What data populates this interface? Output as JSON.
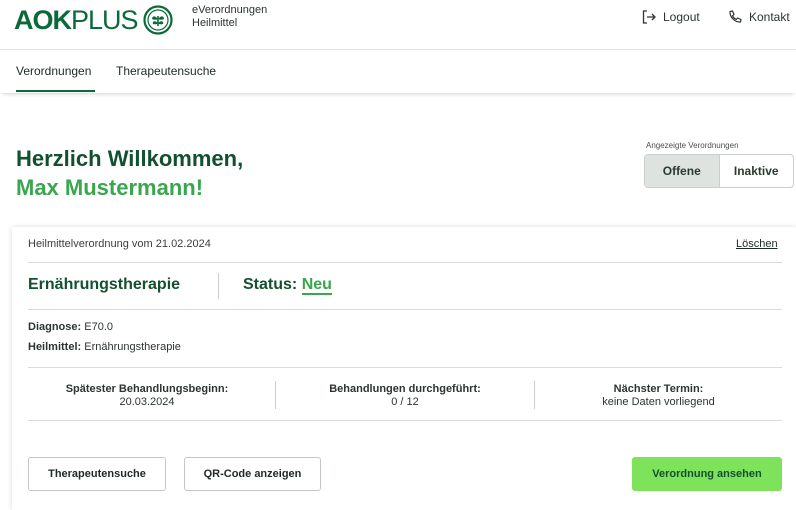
{
  "brand": {
    "logo_bold": "AOK",
    "logo_light": "PLUS"
  },
  "app": {
    "line1": "eVerordnungen",
    "line2": "Heilmittel"
  },
  "header": {
    "logout": "Logout",
    "kontakt": "Kontakt"
  },
  "nav": {
    "tabs": [
      "Verordnungen",
      "Therapeutensuche"
    ]
  },
  "welcome": {
    "line1": "Herzlich Willkommen,",
    "line2": "Max Mustermann!"
  },
  "filter": {
    "label": "Angezeigte Verordnungen",
    "options": [
      "Offene",
      "Inaktive"
    ],
    "selected": "Offene"
  },
  "prescription": {
    "header": "Heilmittelverordnung vom 21.02.2024",
    "delete": "Löschen",
    "therapy": "Ernährungstherapie",
    "status_label": "Status:",
    "status_value": "Neu",
    "diagnosis_label": "Diagnose:",
    "diagnosis_value": "E70.0",
    "remedy_label": "Heilmittel:",
    "remedy_value": "Ernährungstherapie",
    "stats": [
      {
        "title": "Spätester Behandlungsbeginn:",
        "value": "20.03.2024"
      },
      {
        "title": "Behandlungen durchgeführt:",
        "value": "0 / 12"
      },
      {
        "title": "Nächster Termin:",
        "value": "keine Daten vorliegend"
      }
    ],
    "buttons": {
      "search": "Therapeutensuche",
      "qr": "QR-Code anzeigen",
      "view": "Verordnung ansehen"
    }
  },
  "colors": {
    "brand_dark": "#0b6a3a",
    "accent_green": "#3aa64f",
    "primary_button": "#7ee25b"
  },
  "icons": [
    "logo-seal-icon",
    "logout-icon",
    "phone-icon"
  ]
}
